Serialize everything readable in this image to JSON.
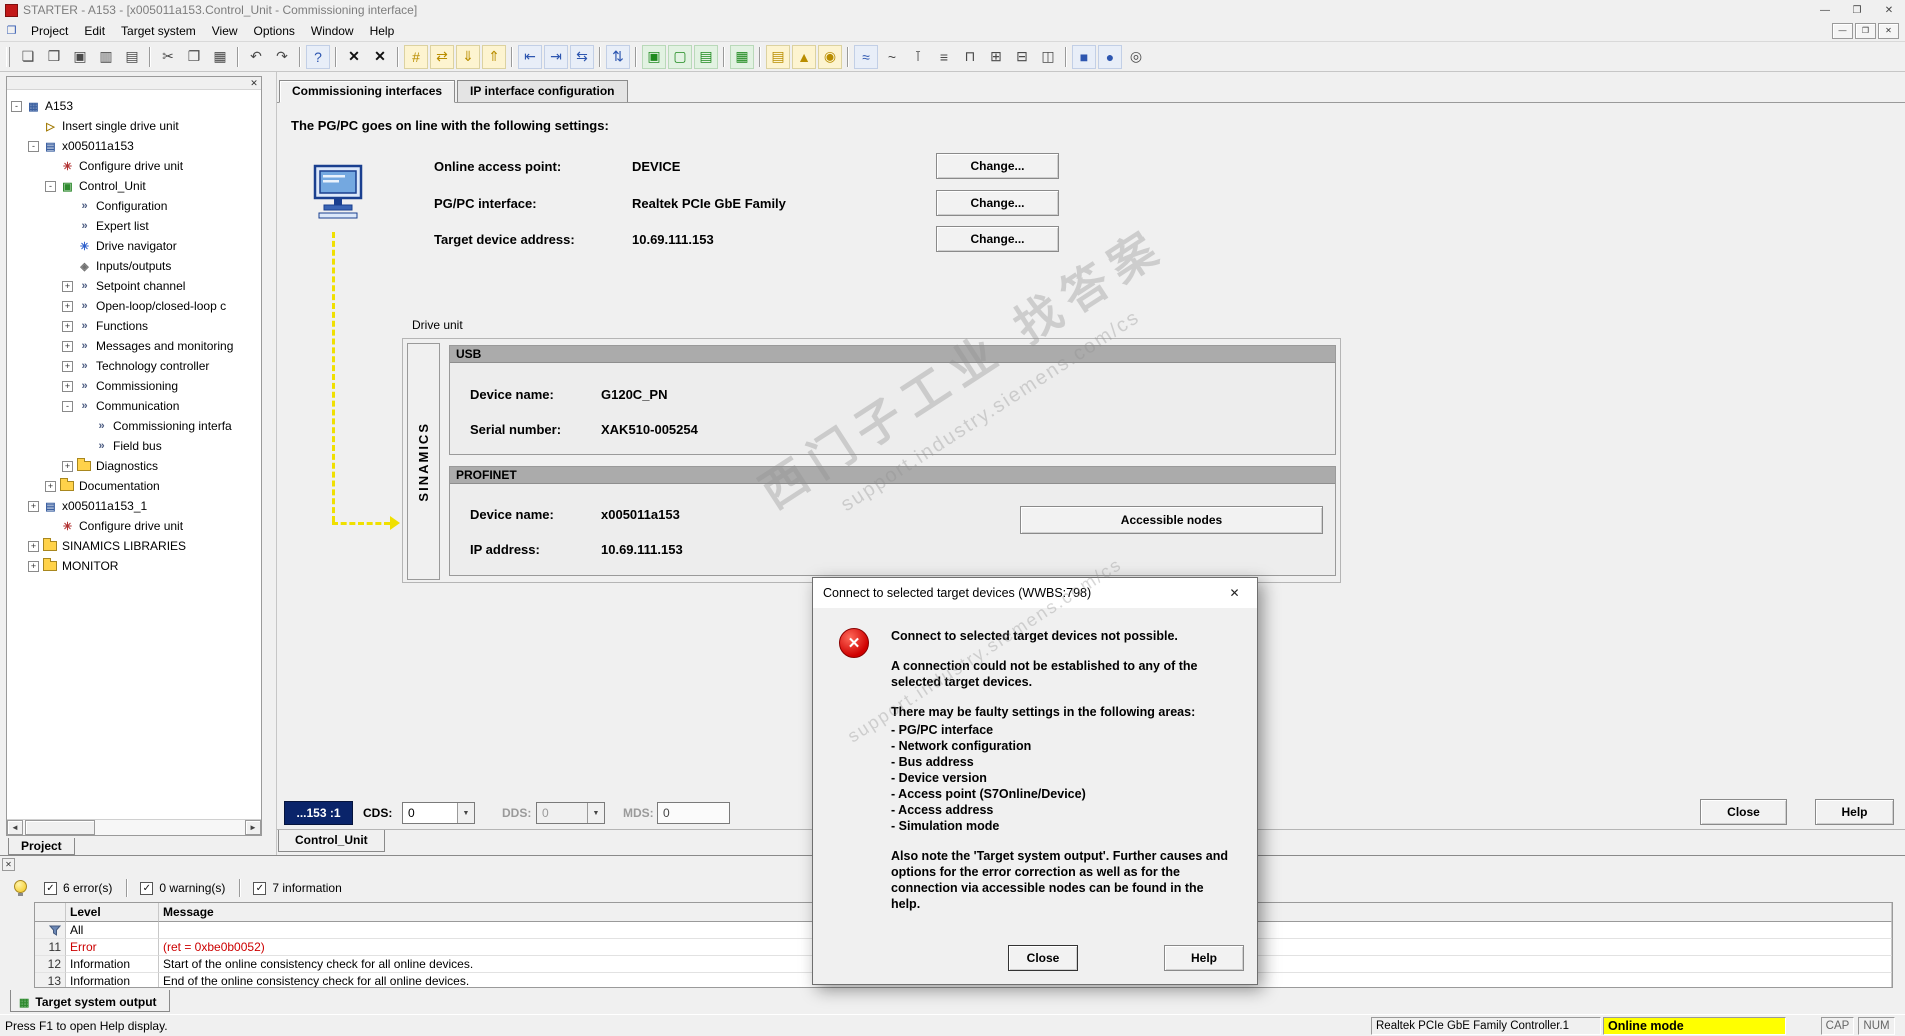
{
  "window": {
    "title": "STARTER - A153 - [x005011a153.Control_Unit - Commissioning interface]"
  },
  "icons": {
    "minimize": "—",
    "restore": "❐",
    "close": "✕",
    "document": "❐",
    "panel_close": "✕",
    "scroll_left": "◄",
    "scroll_right": "►",
    "dropdown": "▼",
    "check": "✓",
    "dialog_close": "✕",
    "error_x": "✕"
  },
  "menu": {
    "items": [
      "Project",
      "Edit",
      "Target system",
      "View",
      "Options",
      "Window",
      "Help"
    ]
  },
  "toolbar": {
    "groups": [
      [
        {
          "name": "new-project-icon",
          "glyph": "❏",
          "tone": "g"
        },
        {
          "name": "open-project-icon",
          "glyph": "❒",
          "tone": "g"
        },
        {
          "name": "save-project-icon",
          "glyph": "▣",
          "tone": "g"
        },
        {
          "name": "archive-project-icon",
          "glyph": "▥",
          "tone": "g"
        },
        {
          "name": "print-icon",
          "glyph": "▤",
          "tone": "g"
        }
      ],
      [
        {
          "name": "cut-icon",
          "glyph": "✂",
          "tone": "g"
        },
        {
          "name": "copy-icon",
          "glyph": "❐",
          "tone": "g"
        },
        {
          "name": "paste-icon",
          "glyph": "▦",
          "tone": "g"
        }
      ],
      [
        {
          "name": "undo-icon",
          "glyph": "↶",
          "tone": "g"
        },
        {
          "name": "redo-icon",
          "glyph": "↷",
          "tone": "g"
        }
      ],
      [
        {
          "name": "help-pointer-icon",
          "glyph": "?",
          "tone": "b"
        }
      ],
      [
        {
          "name": "delete-offline-icon",
          "glyph": "✕",
          "tone": "k"
        },
        {
          "name": "delete-online-icon",
          "glyph": "✕",
          "tone": "k"
        }
      ],
      [
        {
          "name": "accessible-nodes-icon",
          "glyph": "#",
          "tone": "y"
        },
        {
          "name": "connect-target-icon",
          "glyph": "⇄",
          "tone": "y"
        },
        {
          "name": "download-target-icon",
          "glyph": "⇓",
          "tone": "y"
        },
        {
          "name": "upload-target-icon",
          "glyph": "⇑",
          "tone": "y"
        }
      ],
      [
        {
          "name": "insert-device-icon",
          "glyph": "⇤",
          "tone": "b"
        },
        {
          "name": "connect-drive-icon",
          "glyph": "⇥",
          "tone": "b"
        },
        {
          "name": "disconnect-drive-icon",
          "glyph": "⇆",
          "tone": "b"
        }
      ],
      [
        {
          "name": "sort-icon",
          "glyph": "⇅",
          "tone": "b"
        }
      ],
      [
        {
          "name": "online-mode-icon",
          "glyph": "▣",
          "tone": "gr"
        },
        {
          "name": "offline-mode-icon",
          "glyph": "▢",
          "tone": "gr"
        },
        {
          "name": "copy-ram-rom-icon",
          "glyph": "▤",
          "tone": "gr"
        }
      ],
      [
        {
          "name": "network-view-icon",
          "glyph": "▦",
          "tone": "gr"
        }
      ],
      [
        {
          "name": "expert-list-icon",
          "glyph": "▤",
          "tone": "y"
        },
        {
          "name": "alarm-history-icon",
          "glyph": "▲",
          "tone": "y"
        },
        {
          "name": "watch-table-icon",
          "glyph": "◉",
          "tone": "y"
        }
      ],
      [
        {
          "name": "trace-icon",
          "glyph": "≈",
          "tone": "b"
        },
        {
          "name": "function-generator-icon",
          "glyph": "~",
          "tone": "g"
        },
        {
          "name": "measure-icon",
          "glyph": "⊺",
          "tone": "g"
        },
        {
          "name": "bico-icon",
          "glyph": "≡",
          "tone": "g"
        },
        {
          "name": "topology-icon",
          "glyph": "⊓",
          "tone": "g"
        },
        {
          "name": "configuration-icon",
          "glyph": "⊞",
          "tone": "g"
        },
        {
          "name": "limits-icon",
          "glyph": "⊟",
          "tone": "g"
        },
        {
          "name": "diagram-icon",
          "glyph": "◫",
          "tone": "g"
        }
      ],
      [
        {
          "name": "stop-icon",
          "glyph": "■",
          "tone": "b"
        },
        {
          "name": "record-icon",
          "glyph": "●",
          "tone": "b"
        },
        {
          "name": "pause-icon",
          "glyph": "◎",
          "tone": "g"
        }
      ]
    ]
  },
  "tree": {
    "project_tab": "Project",
    "items": [
      {
        "label": "A153",
        "depth": 0,
        "toggle": "-",
        "icon": "project"
      },
      {
        "label": "Insert single drive unit",
        "depth": 1,
        "toggle": null,
        "icon": "insert"
      },
      {
        "label": "x005011a153",
        "depth": 1,
        "toggle": "-",
        "icon": "drive"
      },
      {
        "label": "Configure drive unit",
        "depth": 2,
        "toggle": null,
        "icon": "configure"
      },
      {
        "label": "Control_Unit",
        "depth": 2,
        "toggle": "-",
        "icon": "control"
      },
      {
        "label": "Configuration",
        "depth": 3,
        "toggle": null,
        "icon": "item"
      },
      {
        "label": "Expert list",
        "depth": 3,
        "toggle": null,
        "icon": "item"
      },
      {
        "label": "Drive navigator",
        "depth": 3,
        "toggle": null,
        "icon": "navigator"
      },
      {
        "label": "Inputs/outputs",
        "depth": 3,
        "toggle": null,
        "icon": "io"
      },
      {
        "label": "Setpoint channel",
        "depth": 3,
        "toggle": "+",
        "icon": "item"
      },
      {
        "label": "Open-loop/closed-loop c",
        "depth": 3,
        "toggle": "+",
        "icon": "item"
      },
      {
        "label": "Functions",
        "depth": 3,
        "toggle": "+",
        "icon": "item"
      },
      {
        "label": "Messages and monitoring",
        "depth": 3,
        "toggle": "+",
        "icon": "item"
      },
      {
        "label": "Technology controller",
        "depth": 3,
        "toggle": "+",
        "icon": "item"
      },
      {
        "label": "Commissioning",
        "depth": 3,
        "toggle": "+",
        "icon": "item"
      },
      {
        "label": "Communication",
        "depth": 3,
        "toggle": "-",
        "icon": "item"
      },
      {
        "label": "Commissioning interfa",
        "depth": 4,
        "toggle": null,
        "icon": "item"
      },
      {
        "label": "Field bus",
        "depth": 4,
        "toggle": null,
        "icon": "item"
      },
      {
        "label": "Diagnostics",
        "depth": 3,
        "toggle": "+",
        "icon": "folder"
      },
      {
        "label": "Documentation",
        "depth": 2,
        "toggle": "+",
        "icon": "folder"
      },
      {
        "label": "x005011a153_1",
        "depth": 1,
        "toggle": "+",
        "icon": "drive"
      },
      {
        "label": "Configure drive unit",
        "depth": 2,
        "toggle": null,
        "icon": "configure"
      },
      {
        "label": "SINAMICS LIBRARIES",
        "depth": 1,
        "toggle": "+",
        "icon": "folder"
      },
      {
        "label": "MONITOR",
        "depth": 1,
        "toggle": "+",
        "icon": "folder"
      }
    ]
  },
  "main": {
    "tabs": [
      {
        "label": "Commissioning interfaces"
      },
      {
        "label": "IP interface configuration"
      }
    ],
    "heading": "The PG/PC goes on line with the following settings:",
    "rows": [
      {
        "label": "Online access point:",
        "value": "DEVICE"
      },
      {
        "label": "PG/PC interface:",
        "value": "Realtek PCIe GbE Family"
      },
      {
        "label": "Target device address:",
        "value": "10.69.111.153"
      }
    ],
    "change_label": "Change...",
    "drive_unit_label": "Drive unit",
    "sinamics_label": "SINAMICS",
    "usb": {
      "header": "USB",
      "device_name_label": "Device name:",
      "device_name": "G120C_PN",
      "serial_label": "Serial number:",
      "serial": "XAK510-005254"
    },
    "profinet": {
      "header": "PROFINET",
      "device_name_label": "Device name:",
      "device_name": "x005011a153",
      "ip_label": "IP address:",
      "ip": "10.69.111.153",
      "accessible_nodes_label": "Accessible nodes"
    },
    "bottom": {
      "ds": "...153 :1",
      "cds_label": "CDS:",
      "cds_value": "0",
      "dds_label": "DDS:",
      "dds_value": "0",
      "mds_label": "MDS:",
      "mds_value": "0",
      "close_label": "Close",
      "help_label": "Help"
    },
    "control_unit_tab": "Control_Unit"
  },
  "dialog": {
    "title": "Connect to selected target devices (WWBS:798)",
    "p1": "Connect to selected target devices not possible.",
    "p2": "A connection could not be established to any of the selected target devices.",
    "p3": "There may be faulty settings in the following areas:",
    "areas": [
      "- PG/PC interface",
      "- Network configuration",
      "- Bus address",
      "- Device version",
      "- Access point (S7Online/Device)",
      "- Access address",
      "- Simulation mode"
    ],
    "p4": "Also note the 'Target system output'. Further causes and options for the error correction as well as for the connection via accessible nodes can be found in the help.",
    "close_label": "Close",
    "help_label": "Help"
  },
  "messages": {
    "filters": [
      {
        "label": "6 error(s)",
        "checked": true
      },
      {
        "label": "0 warning(s)",
        "checked": true
      },
      {
        "label": "7 information",
        "checked": true
      }
    ],
    "columns": [
      "Level",
      "Message"
    ],
    "filter_value": "All",
    "rows": [
      {
        "num": "11",
        "level": "Error",
        "message": "(ret = 0xbe0b0052)",
        "error": true
      },
      {
        "num": "12",
        "level": "Information",
        "message": "Start of the online consistency check for all online devices.",
        "error": false
      },
      {
        "num": "13",
        "level": "Information",
        "message": "End of the online consistency check for all online devices.",
        "error": false
      }
    ],
    "tab_label": "Target system output"
  },
  "status": {
    "help_text": "Press F1 to open Help display.",
    "controller": "Realtek PCIe GbE Family Controller.1",
    "mode": "Online mode",
    "cap": "CAP",
    "num": "NUM"
  },
  "watermark": {
    "line1": "西门子工业 找答案",
    "line2": "support.industry.siemens.com/cs"
  }
}
